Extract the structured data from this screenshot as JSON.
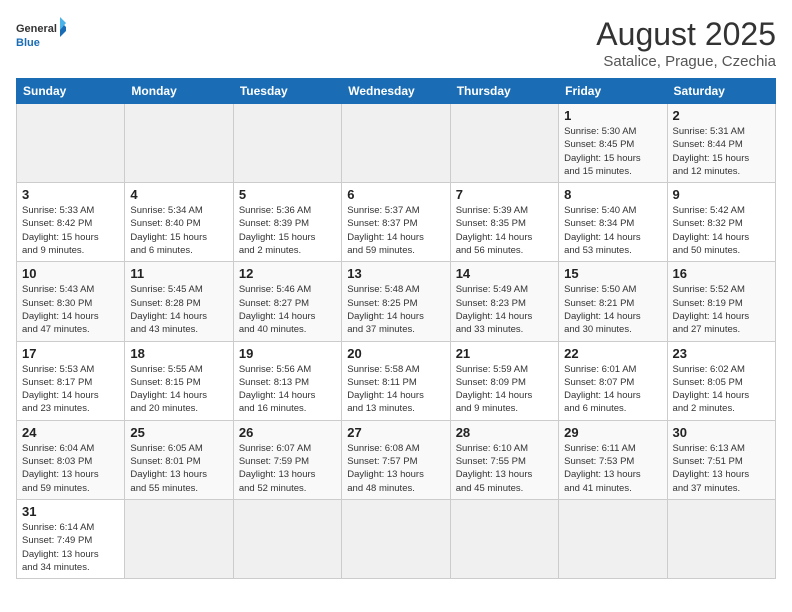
{
  "header": {
    "logo_general": "General",
    "logo_blue": "Blue",
    "title": "August 2025",
    "subtitle": "Satalice, Prague, Czechia"
  },
  "weekdays": [
    "Sunday",
    "Monday",
    "Tuesday",
    "Wednesday",
    "Thursday",
    "Friday",
    "Saturday"
  ],
  "weeks": [
    [
      {
        "day": "",
        "info": ""
      },
      {
        "day": "",
        "info": ""
      },
      {
        "day": "",
        "info": ""
      },
      {
        "day": "",
        "info": ""
      },
      {
        "day": "",
        "info": ""
      },
      {
        "day": "1",
        "info": "Sunrise: 5:30 AM\nSunset: 8:45 PM\nDaylight: 15 hours\nand 15 minutes."
      },
      {
        "day": "2",
        "info": "Sunrise: 5:31 AM\nSunset: 8:44 PM\nDaylight: 15 hours\nand 12 minutes."
      }
    ],
    [
      {
        "day": "3",
        "info": "Sunrise: 5:33 AM\nSunset: 8:42 PM\nDaylight: 15 hours\nand 9 minutes."
      },
      {
        "day": "4",
        "info": "Sunrise: 5:34 AM\nSunset: 8:40 PM\nDaylight: 15 hours\nand 6 minutes."
      },
      {
        "day": "5",
        "info": "Sunrise: 5:36 AM\nSunset: 8:39 PM\nDaylight: 15 hours\nand 2 minutes."
      },
      {
        "day": "6",
        "info": "Sunrise: 5:37 AM\nSunset: 8:37 PM\nDaylight: 14 hours\nand 59 minutes."
      },
      {
        "day": "7",
        "info": "Sunrise: 5:39 AM\nSunset: 8:35 PM\nDaylight: 14 hours\nand 56 minutes."
      },
      {
        "day": "8",
        "info": "Sunrise: 5:40 AM\nSunset: 8:34 PM\nDaylight: 14 hours\nand 53 minutes."
      },
      {
        "day": "9",
        "info": "Sunrise: 5:42 AM\nSunset: 8:32 PM\nDaylight: 14 hours\nand 50 minutes."
      }
    ],
    [
      {
        "day": "10",
        "info": "Sunrise: 5:43 AM\nSunset: 8:30 PM\nDaylight: 14 hours\nand 47 minutes."
      },
      {
        "day": "11",
        "info": "Sunrise: 5:45 AM\nSunset: 8:28 PM\nDaylight: 14 hours\nand 43 minutes."
      },
      {
        "day": "12",
        "info": "Sunrise: 5:46 AM\nSunset: 8:27 PM\nDaylight: 14 hours\nand 40 minutes."
      },
      {
        "day": "13",
        "info": "Sunrise: 5:48 AM\nSunset: 8:25 PM\nDaylight: 14 hours\nand 37 minutes."
      },
      {
        "day": "14",
        "info": "Sunrise: 5:49 AM\nSunset: 8:23 PM\nDaylight: 14 hours\nand 33 minutes."
      },
      {
        "day": "15",
        "info": "Sunrise: 5:50 AM\nSunset: 8:21 PM\nDaylight: 14 hours\nand 30 minutes."
      },
      {
        "day": "16",
        "info": "Sunrise: 5:52 AM\nSunset: 8:19 PM\nDaylight: 14 hours\nand 27 minutes."
      }
    ],
    [
      {
        "day": "17",
        "info": "Sunrise: 5:53 AM\nSunset: 8:17 PM\nDaylight: 14 hours\nand 23 minutes."
      },
      {
        "day": "18",
        "info": "Sunrise: 5:55 AM\nSunset: 8:15 PM\nDaylight: 14 hours\nand 20 minutes."
      },
      {
        "day": "19",
        "info": "Sunrise: 5:56 AM\nSunset: 8:13 PM\nDaylight: 14 hours\nand 16 minutes."
      },
      {
        "day": "20",
        "info": "Sunrise: 5:58 AM\nSunset: 8:11 PM\nDaylight: 14 hours\nand 13 minutes."
      },
      {
        "day": "21",
        "info": "Sunrise: 5:59 AM\nSunset: 8:09 PM\nDaylight: 14 hours\nand 9 minutes."
      },
      {
        "day": "22",
        "info": "Sunrise: 6:01 AM\nSunset: 8:07 PM\nDaylight: 14 hours\nand 6 minutes."
      },
      {
        "day": "23",
        "info": "Sunrise: 6:02 AM\nSunset: 8:05 PM\nDaylight: 14 hours\nand 2 minutes."
      }
    ],
    [
      {
        "day": "24",
        "info": "Sunrise: 6:04 AM\nSunset: 8:03 PM\nDaylight: 13 hours\nand 59 minutes."
      },
      {
        "day": "25",
        "info": "Sunrise: 6:05 AM\nSunset: 8:01 PM\nDaylight: 13 hours\nand 55 minutes."
      },
      {
        "day": "26",
        "info": "Sunrise: 6:07 AM\nSunset: 7:59 PM\nDaylight: 13 hours\nand 52 minutes."
      },
      {
        "day": "27",
        "info": "Sunrise: 6:08 AM\nSunset: 7:57 PM\nDaylight: 13 hours\nand 48 minutes."
      },
      {
        "day": "28",
        "info": "Sunrise: 6:10 AM\nSunset: 7:55 PM\nDaylight: 13 hours\nand 45 minutes."
      },
      {
        "day": "29",
        "info": "Sunrise: 6:11 AM\nSunset: 7:53 PM\nDaylight: 13 hours\nand 41 minutes."
      },
      {
        "day": "30",
        "info": "Sunrise: 6:13 AM\nSunset: 7:51 PM\nDaylight: 13 hours\nand 37 minutes."
      }
    ],
    [
      {
        "day": "31",
        "info": "Sunrise: 6:14 AM\nSunset: 7:49 PM\nDaylight: 13 hours\nand 34 minutes."
      },
      {
        "day": "",
        "info": ""
      },
      {
        "day": "",
        "info": ""
      },
      {
        "day": "",
        "info": ""
      },
      {
        "day": "",
        "info": ""
      },
      {
        "day": "",
        "info": ""
      },
      {
        "day": "",
        "info": ""
      }
    ]
  ]
}
